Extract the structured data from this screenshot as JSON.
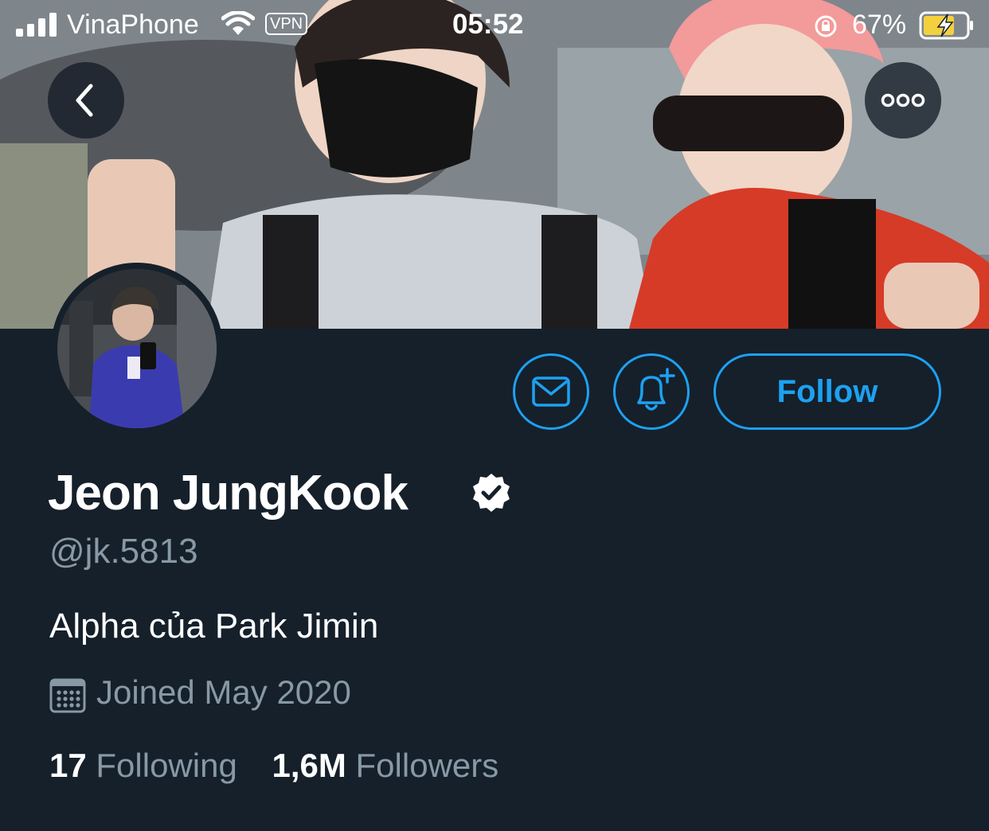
{
  "status_bar": {
    "carrier": "VinaPhone",
    "vpn": "VPN",
    "time": "05:52",
    "battery": "67%"
  },
  "profile": {
    "display_name": "Jeon JungKook",
    "handle": "@jk.5813",
    "bio": "Alpha của Park Jimin",
    "joined": "Joined May 2020",
    "following_count": "17",
    "following_label": "Following",
    "followers_count": "1,6M",
    "followers_label": "Followers"
  },
  "actions": {
    "follow_label": "Follow"
  },
  "icons": {
    "back": "chevron-left-icon",
    "more": "more-icon",
    "message": "mail-icon",
    "notifications": "bell-plus-icon",
    "verified": "verified-badge-icon",
    "calendar": "calendar-icon"
  },
  "colors": {
    "background": "#15202b",
    "accent": "#1da1f2",
    "secondary_text": "#8899a6"
  }
}
